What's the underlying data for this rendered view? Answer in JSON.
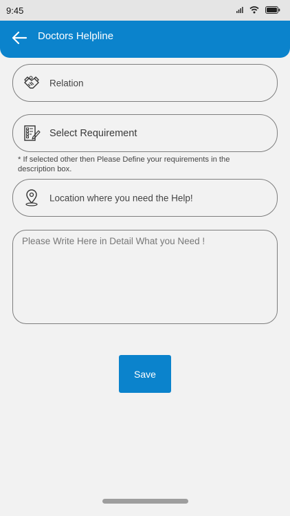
{
  "status_bar": {
    "time": "9:45",
    "icons": [
      "signal-icon",
      "wifi-icon",
      "battery-icon"
    ]
  },
  "app_bar": {
    "title": "Doctors Helpline",
    "color": "#0b83cc",
    "back_icon": "back-arrow-icon"
  },
  "form": {
    "relation": {
      "label": "Relation",
      "icon": "handshake-icon"
    },
    "requirement": {
      "label": "Select Requirement",
      "icon": "document-edit-icon"
    },
    "note": "* If selected other then Please Define your requirements in the description box.",
    "location": {
      "label": "Location where you need the Help!",
      "icon": "location-pin-icon"
    },
    "details": {
      "placeholder": "Please Write Here in Detail What you Need !"
    },
    "save_label": "Save"
  }
}
